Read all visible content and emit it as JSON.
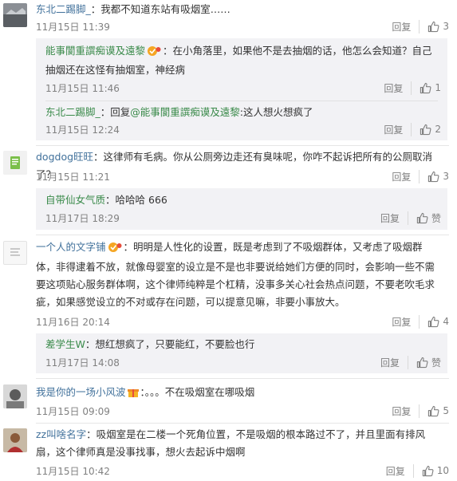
{
  "comments": [
    {
      "name": "东北二踢脚_",
      "text": "：我都不知道东站有吸烟室……",
      "time": "11月15日 11:39",
      "reply_label": "回复",
      "likes": "3",
      "replies": [
        {
          "name": "能事閬重譔痴谟及遠黎",
          "text": "：在小角落里，如果他不是去抽烟的话，他怎么会知道？自己抽烟还在这怪有抽烟室，神经病",
          "time": "11月15日 11:46",
          "reply_label": "回复",
          "likes": "1"
        },
        {
          "name": "东北二踢脚_",
          "text_prefix": "：回复",
          "mention": "@能事閬重譔痴谟及遠黎",
          "text": ":这人想火想疯了",
          "time": "11月15日 12:24",
          "reply_label": "回复",
          "likes": "2"
        }
      ]
    },
    {
      "name": "dogdog旺旺",
      "text": "：这律师有毛病。你从公厕旁边走还有臭味呢，你咋不起诉把所有的公厕取消了？",
      "time": "11月15日 11:21",
      "reply_label": "回复",
      "likes": "3",
      "replies": [
        {
          "name": "自带仙女气质",
          "text": "：哈哈哈 666",
          "time": "11月17日 18:29",
          "reply_label": "回复",
          "likes": "赞"
        }
      ]
    },
    {
      "name": "一个人的文字铺",
      "text": "：明明是人性化的设置，既是考虑到了不吸烟群体，又考虑了吸烟群体，非得逮着不放，就像母婴室的设立是不是也非要说给她们方便的同时，会影响一些不需要这项贴心服务群体啊，这个律师纯粹是个杠精，没事多关心社会热点问题，不要老吹毛求疵，如果感觉设立的不对或存在问题，可以提意见嘛，非要小事放大。",
      "time": "11月16日 20:14",
      "reply_label": "回复",
      "likes": "4",
      "replies": [
        {
          "name": "差学生W",
          "text": "：想红想疯了，只要能红，不要脸也行",
          "time": "11月17日 14:08",
          "reply_label": "回复",
          "likes": "赞"
        }
      ]
    },
    {
      "name": "我是你的一场小风波",
      "text": "：。。。不在吸烟室在哪吸烟",
      "time": "11月15日 09:09",
      "reply_label": "回复",
      "likes": "5"
    },
    {
      "name": "zz叫啥名字",
      "text": "：吸烟室是在二楼一个死角位置，不是吸烟的根本路过不了，并且里面有排风扇，这个律师真是没事找事，想火去起诉中烟啊",
      "time": "11月15日 10:42",
      "reply_label": "回复",
      "likes": "10"
    }
  ],
  "colors": {
    "name": "#eb7350",
    "reply_bg": "#f2f2f5",
    "meta": "#808080"
  },
  "icons": [
    "thumbs-up-icon",
    "verified-badge-icon",
    "gift-badge-icon"
  ]
}
